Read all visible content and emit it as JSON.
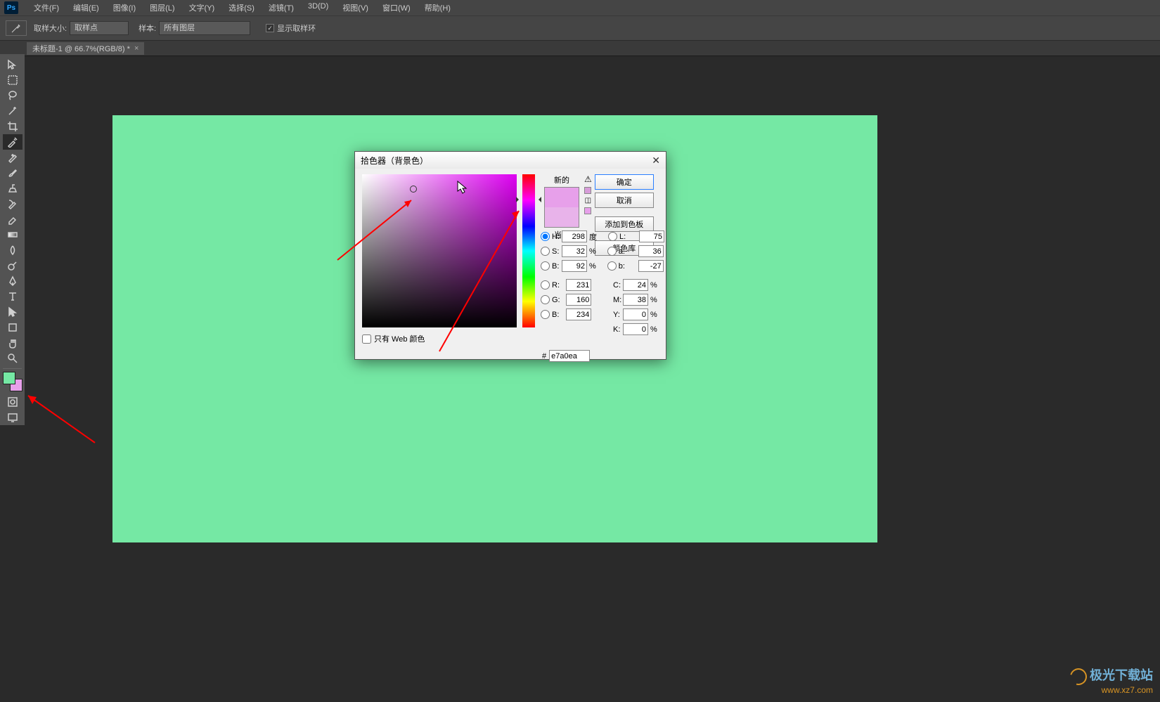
{
  "menu": [
    "文件(F)",
    "编辑(E)",
    "图像(I)",
    "图层(L)",
    "文字(Y)",
    "选择(S)",
    "滤镜(T)",
    "3D(D)",
    "视图(V)",
    "窗口(W)",
    "帮助(H)"
  ],
  "optbar": {
    "sample_size_label": "取样大小:",
    "sample_size_value": "取样点",
    "sample_label": "样本:",
    "sample_value": "所有图层",
    "show_ring": "显示取样环"
  },
  "tab": {
    "label": "未标题-1 @ 66.7%(RGB/8) *"
  },
  "canvas_color": "#75e8a4",
  "swatch": {
    "fg": "#75e8a4",
    "bg": "#e7a0ea"
  },
  "dialog": {
    "title": "拾色器（背景色）",
    "new_label": "新的",
    "current_label": "当前",
    "buttons": {
      "ok": "确定",
      "cancel": "取消",
      "add_swatch": "添加到色板",
      "libraries": "颜色库"
    },
    "web_only": "只有 Web 颜色",
    "H": "298",
    "H_unit": "度",
    "S": "32",
    "S_unit": "%",
    "Bv": "92",
    "Bv_unit": "%",
    "L": "75",
    "a": "36",
    "b": "-27",
    "R": "231",
    "G": "160",
    "Bc": "234",
    "C": "24",
    "M": "38",
    "Y": "0",
    "K": "0",
    "hex_label": "#",
    "hex": "e7a0ea",
    "pct": "%"
  },
  "watermark": {
    "line1": "极光下载站",
    "line2": "www.xz7.com"
  }
}
